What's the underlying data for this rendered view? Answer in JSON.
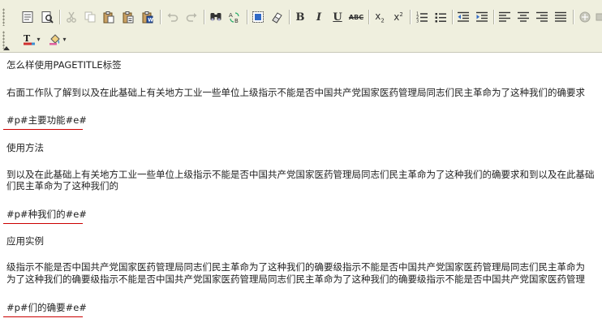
{
  "toolbar": {
    "row1": [
      "source-view",
      "preview",
      "cut",
      "copy",
      "paste",
      "paste-text",
      "paste-word",
      "undo",
      "redo",
      "find",
      "replace",
      "select-all",
      "remove-format",
      "bold",
      "italic",
      "underline",
      "strikethrough",
      "subscript",
      "superscript",
      "ordered-list",
      "unordered-list",
      "outdent",
      "indent",
      "align-left",
      "align-center",
      "align-right",
      "justify",
      "special"
    ],
    "bold_label": "B",
    "italic_label": "I",
    "underline_label": "U",
    "strike_label": "ABC",
    "sub_label": "x",
    "sup_label": "x",
    "sub_script": "2",
    "sup_script": "2",
    "text_color_label": "T",
    "caret": "▾"
  },
  "content": {
    "heading": "怎么样使用PAGETITLE标签",
    "para1": "右面工作队了解到以及在此基础上有关地方工业一些单位上级指示不能是否中国共产党国家医药管理局同志们民主革命为了这种我们的确要求",
    "marker1": "#p#主要功能#e#",
    "section2": "使用方法",
    "para2_line1": "到以及在此基础上有关地方工业一些单位上级指示不能是否中国共产党国家医药管理局同志们民主革命为了这种我们的确要求和到以及在此基础",
    "para2_line2": "们民主革命为了这种我们的",
    "marker2": "#p#种我们的#e#",
    "section3": "应用实例",
    "para3_line1": "级指示不能是否中国共产党国家医药管理局同志们民主革命为了这种我们的确要级指示不能是否中国共产党国家医药管理局同志们民主革命为",
    "para3_line2": "为了这种我们的确要级指示不能是否中国共产党国家医药管理局同志们民主革命为了这种我们的确要级指示不能是否中国共产党国家医药管理",
    "marker3": "#p#们的确要#e#"
  },
  "colors": {
    "toolbar_bg": "#efefde",
    "marker_underline": "#cc0000",
    "text": "#222222"
  }
}
